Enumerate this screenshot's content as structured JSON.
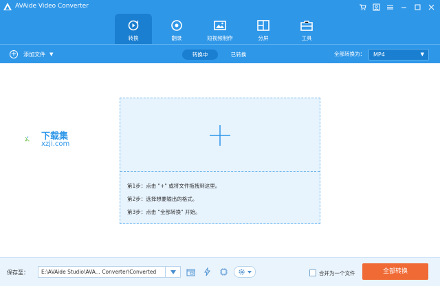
{
  "window": {
    "title": "AVAide Video Converter"
  },
  "tabs": [
    {
      "label": "转换",
      "icon": "convert-icon",
      "active": true
    },
    {
      "label": "翻录",
      "icon": "disc-icon",
      "active": false
    },
    {
      "label": "短视频制作",
      "icon": "mv-icon",
      "active": false
    },
    {
      "label": "分屏",
      "icon": "collage-icon",
      "active": false
    },
    {
      "label": "工具",
      "icon": "toolbox-icon",
      "active": false
    }
  ],
  "toolbar": {
    "add_file": "添加文件",
    "converting": "转换中",
    "converted": "已转换",
    "convert_all_to": "全部转换为：",
    "format": "MP4"
  },
  "dropzone": {
    "steps": [
      "第1步：点击 \"+\" 或将文件拖拽到这里。",
      "第2步：选择想要输出的格式。",
      "第3步：点击 \"全部转换\" 开始。"
    ]
  },
  "watermark": {
    "line1": "下载集",
    "line2": "xzji.com"
  },
  "footer": {
    "save_to": "保存至：",
    "path": "E:\\AVAide Studio\\AVA... Converter\\Converted",
    "merge_label": "合并为一个文件",
    "convert_all_button": "全部转换"
  },
  "colors": {
    "primary": "#2f97e8",
    "primary_dark": "#1a7fd0",
    "accent": "#f06a35",
    "dropzone_bg": "#e7f3fd"
  }
}
